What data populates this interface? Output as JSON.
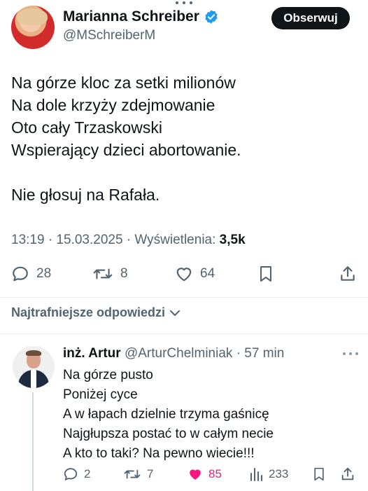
{
  "tweet": {
    "author_name": "Marianna Schreiber",
    "author_handle": "@MSchreiberM",
    "follow_label": "Obserwuj",
    "lines": [
      "Na górze kloc za setki milionów",
      "Na dole krzyży zdejmowanie",
      "Oto cały Trzaskowski",
      "Wspierający dzieci abortowanie.",
      "",
      "Nie głosuj na Rafała."
    ],
    "timestamp": "13:19 · 15.03.2025 · Wyświetlenia: ",
    "views": "3,5k",
    "replies": "28",
    "reposts": "8",
    "likes": "64"
  },
  "replies_sort": {
    "label": "Najtrafniejsze odpowiedzi"
  },
  "reply": {
    "author_name": "inż. Artur",
    "author_handle": "@ArturChelminiak",
    "time": " · 57 min",
    "lines": [
      "Na górze pusto",
      "Poniżej cyce",
      "A w łapach dzielnie trzyma gaśnicę",
      "Najgłupsza postać to w całym necie",
      "A kto to taki? Na pewno wiecie!!!"
    ],
    "replies": "2",
    "reposts": "7",
    "likes": "85",
    "views": "233"
  },
  "colors": {
    "accent_blue": "#1d9bf0",
    "like_pink": "#f91880",
    "muted": "#536471"
  }
}
